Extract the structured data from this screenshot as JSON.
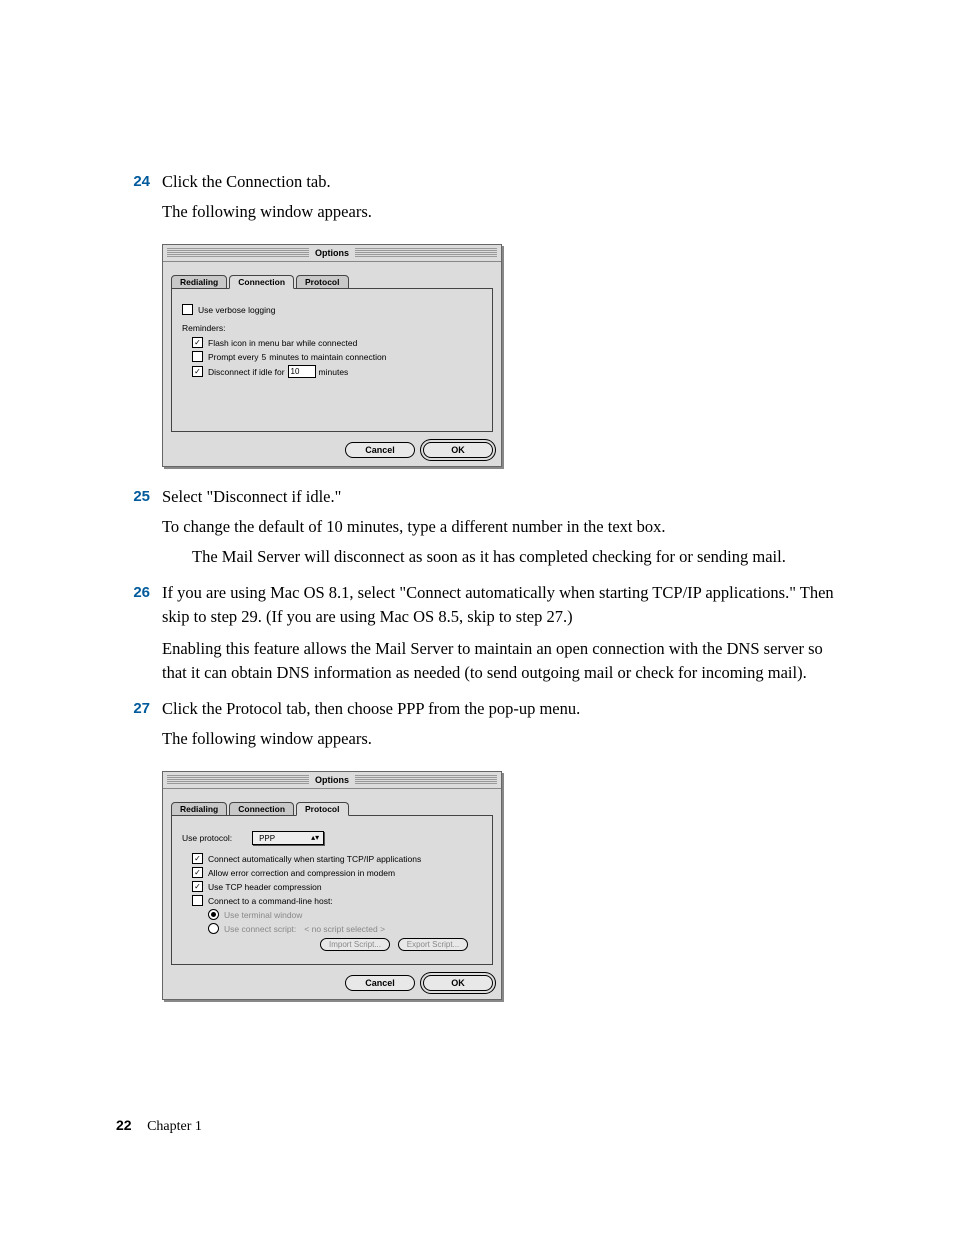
{
  "steps": {
    "s24": {
      "num": "24",
      "line1": "Click the Connection tab.",
      "line2": "The following window appears."
    },
    "s25": {
      "num": "25",
      "line1": "Select \"Disconnect if idle.\"",
      "line2": "To change the default of 10 minutes, type a different number in the text box.",
      "line3": "The Mail Server will disconnect as soon as it has completed checking for or sending mail."
    },
    "s26": {
      "num": "26",
      "line1": "If you are using Mac OS 8.1, select \"Connect automatically when starting TCP/IP applications.\" Then skip to step 29. (If you are using Mac OS 8.5, skip to step 27.)",
      "line2": "Enabling this feature allows the Mail Server to maintain an open connection with the DNS server so that it can obtain DNS information as needed (to send outgoing mail or check for incoming mail)."
    },
    "s27": {
      "num": "27",
      "line1": "Click the Protocol tab, then choose PPP from the pop-up menu.",
      "line2": "The following window appears."
    }
  },
  "win1": {
    "title": "Options",
    "tabs": {
      "t1": "Redialing",
      "t2": "Connection",
      "t3": "Protocol"
    },
    "verbose": "Use verbose logging",
    "reminders": "Reminders:",
    "flash": "Flash icon in menu bar while connected",
    "prompt_a": "Prompt every",
    "prompt_val": "5",
    "prompt_b": "minutes to maintain connection",
    "disc_a": "Disconnect if idle for",
    "disc_val": "10",
    "disc_b": "minutes",
    "cancel": "Cancel",
    "ok": "OK"
  },
  "win2": {
    "title": "Options",
    "tabs": {
      "t1": "Redialing",
      "t2": "Connection",
      "t3": "Protocol"
    },
    "use_protocol_label": "Use protocol:",
    "protocol_value": "PPP",
    "c1": "Connect automatically when starting TCP/IP applications",
    "c2": "Allow error correction and compression in modem",
    "c3": "Use TCP header compression",
    "c4": "Connect to a command-line host:",
    "r1": "Use terminal window",
    "r2": "Use connect script:",
    "noscript": "< no script selected >",
    "import": "Import Script...",
    "export": "Export Script...",
    "cancel": "Cancel",
    "ok": "OK"
  },
  "footer": {
    "page": "22",
    "chapter": "Chapter 1"
  }
}
